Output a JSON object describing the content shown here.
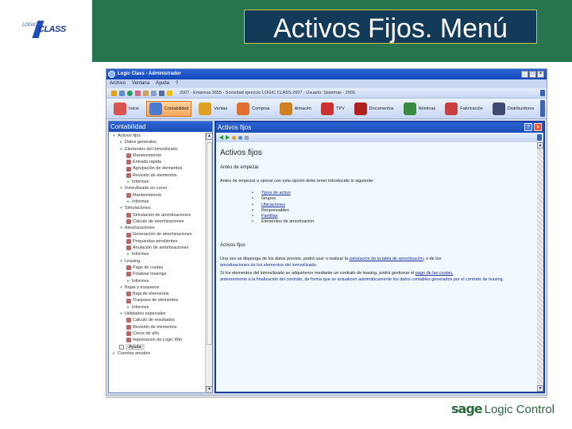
{
  "slide": {
    "title": "Activos Fijos. Menú",
    "logo_small": "LOGIC",
    "logo_big": "CLASS",
    "footer_brand": "sage",
    "footer_text": "Logic Control",
    "colors": {
      "header_green": "#27744d",
      "title_bg": "#143a5a",
      "title_border": "#c9c04a"
    }
  },
  "app": {
    "window_title": "Logic Class - Administrador",
    "window_buttons": [
      "_",
      "□",
      "×"
    ],
    "menu": [
      "Archivo",
      "Ventana",
      "Ayuda",
      "?"
    ],
    "quick_status": "2007 - Empresa 3655 - Sociedad ejercicio LOGIC CLASS 2007 - Usuario: Sistemas - 2005",
    "toolbar": [
      {
        "label": "Inicio",
        "icon": "home-icon",
        "color": "#d9534f"
      },
      {
        "label": "Contabilidad",
        "icon": "accounting-icon",
        "color": "#4a7bd0",
        "active": true
      },
      {
        "label": "Ventas",
        "icon": "sales-icon",
        "color": "#e0a020"
      },
      {
        "label": "Compras",
        "icon": "purchases-icon",
        "color": "#e07030"
      },
      {
        "label": "Almacén",
        "icon": "warehouse-icon",
        "color": "#d08020"
      },
      {
        "label": "TPV",
        "icon": "pos-icon",
        "color": "#cc3030"
      },
      {
        "label": "Documentos",
        "icon": "documents-icon",
        "color": "#b02020"
      },
      {
        "label": "Nóminas",
        "icon": "payroll-icon",
        "color": "#3a8a40"
      },
      {
        "label": "Fabricación",
        "icon": "manufacturing-icon",
        "color": "#c84040"
      },
      {
        "label": "Distribuidores",
        "icon": "distributors-icon",
        "color": "#404a70"
      }
    ],
    "left_pane": {
      "title": "Contabilidad",
      "tree": [
        {
          "level": 1,
          "label": "Activos fijos",
          "type": "folder-open"
        },
        {
          "level": 2,
          "label": "Datos generales",
          "type": "folder-closed"
        },
        {
          "level": 2,
          "label": "Elementos del inmovilizado",
          "type": "folder-open"
        },
        {
          "level": 3,
          "label": "Mantenimiento",
          "type": "item"
        },
        {
          "level": 3,
          "label": "Entrada rápida",
          "type": "item"
        },
        {
          "level": 3,
          "label": "Agrupación de elementos",
          "type": "item"
        },
        {
          "level": 3,
          "label": "Revisión de elementos",
          "type": "item"
        },
        {
          "level": 3,
          "label": "Informes",
          "type": "folder-closed"
        },
        {
          "level": 2,
          "label": "Inmovilizado en curso",
          "type": "folder-open"
        },
        {
          "level": 3,
          "label": "Mantenimiento",
          "type": "item"
        },
        {
          "level": 3,
          "label": "Informes",
          "type": "folder-closed"
        },
        {
          "level": 2,
          "label": "Simulaciones",
          "type": "folder-open"
        },
        {
          "level": 3,
          "label": "Simulación de amortizaciones",
          "type": "item"
        },
        {
          "level": 3,
          "label": "Cálculo de amortizaciones",
          "type": "item"
        },
        {
          "level": 2,
          "label": "Amortizaciones",
          "type": "folder-open"
        },
        {
          "level": 3,
          "label": "Generación de amortizaciones",
          "type": "item"
        },
        {
          "level": 3,
          "label": "Propuestas pendientes",
          "type": "item"
        },
        {
          "level": 3,
          "label": "Anulación de amortizaciones",
          "type": "item"
        },
        {
          "level": 3,
          "label": "Informes",
          "type": "folder-closed"
        },
        {
          "level": 2,
          "label": "Leasing",
          "type": "folder-open"
        },
        {
          "level": 3,
          "label": "Pago de cuotas",
          "type": "item"
        },
        {
          "level": 3,
          "label": "Finalizar leasings",
          "type": "item"
        },
        {
          "level": 3,
          "label": "Informes",
          "type": "folder-closed"
        },
        {
          "level": 2,
          "label": "Bajas y traspasos",
          "type": "folder-open"
        },
        {
          "level": 3,
          "label": "Baja de elementos",
          "type": "item"
        },
        {
          "level": 3,
          "label": "Traspaso de elementos",
          "type": "item"
        },
        {
          "level": 3,
          "label": "Informes",
          "type": "folder-closed"
        },
        {
          "level": 2,
          "label": "Utilidades especiales",
          "type": "folder-open"
        },
        {
          "level": 3,
          "label": "Cálculo de resultados",
          "type": "item"
        },
        {
          "level": 3,
          "label": "Revisión de elementos",
          "type": "item"
        },
        {
          "level": 3,
          "label": "Cierre de año",
          "type": "item"
        },
        {
          "level": 3,
          "label": "Importación de Logic Win",
          "type": "item"
        },
        {
          "level": 2,
          "label": "Ayuda",
          "type": "help",
          "selected": true
        },
        {
          "level": 1,
          "label": "Cuentas anuales",
          "type": "folder-closed"
        }
      ]
    },
    "right_pane": {
      "title": "Activos fijos",
      "toolbar_icons": [
        "back-icon",
        "forward-icon",
        "home-icon",
        "refresh-icon",
        "print-icon"
      ],
      "heading": "Activos fijos",
      "section1_title": "Antes de empezar",
      "section1_text": "Antes de empezar a operar con esta opción debe tener introducido lo siguiente:",
      "prereq_list": [
        {
          "label": "Tipos de activo",
          "link": true
        },
        {
          "label": "Grupos",
          "link": false
        },
        {
          "label": "Ubicaciones",
          "link": true
        },
        {
          "label": "Responsables",
          "link": false
        },
        {
          "label": "Familias",
          "link": true
        },
        {
          "label": "Elementos de amortización",
          "link": false
        }
      ],
      "section2_title": "Activos fijos",
      "para1_pre": "Una vez se disponga de los datos previos, podrá usar o realizar la ",
      "para1_link": "simulación de la tabla de amortización",
      "para1_post": ", o de los",
      "para1_line2": "amortizaciones de los elementos del inmovilizado.",
      "para2_pre": "Si los elementos del inmovilizado se adquirieron mediante un contrato de leasing, podrá gestionar el ",
      "para2_link": "pago de las cuotas,",
      "para2_line2": "anteriormente a la finalización del contrato, de forma que se actualicen automáticamente los datos contables generados por el contrato de leasing."
    }
  }
}
